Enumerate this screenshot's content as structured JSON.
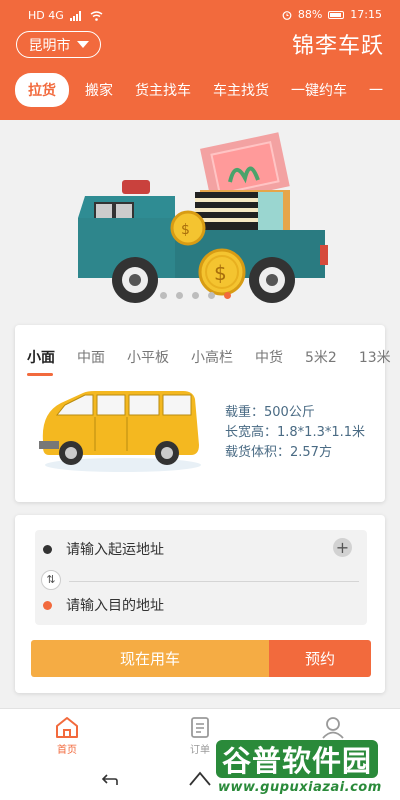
{
  "status_bar": {
    "left_text": "HD 4G",
    "battery": "88%",
    "time": "17:15"
  },
  "header": {
    "city": "昆明市",
    "app_title": "锦李车跃",
    "tabs": [
      "拉货",
      "搬家",
      "货主找车",
      "车主找货",
      "一键约车",
      "一"
    ],
    "active_tab": 0
  },
  "banner": {
    "slide_count": 5,
    "active_slide": 4,
    "icons": [
      "delivery-truck-illustration",
      "coin-dollar-icon"
    ]
  },
  "vehicle": {
    "tabs": [
      "小面",
      "中面",
      "小平板",
      "小高栏",
      "中货",
      "5米2",
      "13米"
    ],
    "active_tab": 0,
    "specs": [
      "载重：500公斤",
      "长宽高：1.8*1.3*1.1米",
      "载货体积：2.57方"
    ]
  },
  "address": {
    "start_placeholder": "请输入起运地址",
    "end_placeholder": "请输入目的地址",
    "start_color": "#333333",
    "end_color": "#f26a3d",
    "use_now_label": "现在用车",
    "reserve_label": "预约"
  },
  "bottom_nav": [
    {
      "label": "首页",
      "icon": "home-icon",
      "active": true
    },
    {
      "label": "订单",
      "icon": "order-icon",
      "active": false
    },
    {
      "label": "",
      "icon": "user-icon",
      "active": false
    }
  ],
  "watermark": {
    "text": "谷普软件园",
    "url": "www.gupuxiazai.com"
  },
  "colors": {
    "brand": "#f26a3d",
    "secondary": "#f5ac44",
    "background": "#f1f1f1"
  }
}
